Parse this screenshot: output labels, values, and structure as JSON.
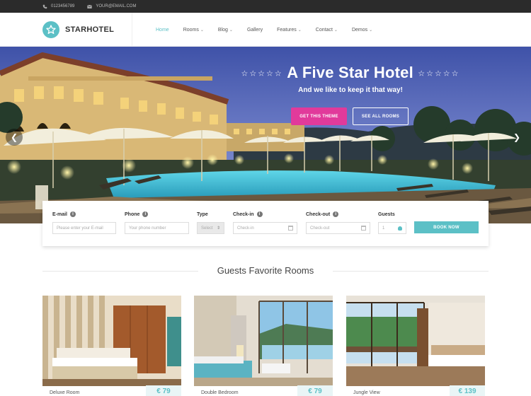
{
  "topbar": {
    "phone": "0123456789",
    "email": "YOUR@EMAIL.COM"
  },
  "brand": {
    "name": "STARHOTEL",
    "accent": "#5cc0c6",
    "pink": "#e13a9b"
  },
  "nav": {
    "items": [
      {
        "label": "Home",
        "dropdown": false,
        "active": true
      },
      {
        "label": "Rooms",
        "dropdown": true
      },
      {
        "label": "Blog",
        "dropdown": true
      },
      {
        "label": "Gallery",
        "dropdown": false
      },
      {
        "label": "Features",
        "dropdown": true
      },
      {
        "label": "Contact",
        "dropdown": true
      },
      {
        "label": "Demos",
        "dropdown": true
      }
    ]
  },
  "hero": {
    "title": "A Five Star Hotel",
    "stars_left": "☆☆☆☆☆",
    "stars_right": "☆☆☆☆☆",
    "subtitle": "And we like to keep it that way!",
    "primary_button": "GET THIS THEME",
    "secondary_button": "SEE ALL ROOMS"
  },
  "booking": {
    "email_label": "E-mail",
    "email_placeholder": "Please enter your E-mail",
    "phone_label": "Phone",
    "phone_placeholder": "Your phone number",
    "type_label": "Type",
    "type_value": "Select",
    "checkin_label": "Check-in",
    "checkin_placeholder": "Check-in",
    "checkout_label": "Check-out",
    "checkout_placeholder": "Check-out",
    "guests_label": "Guests",
    "guests_value": "1",
    "book_button": "BOOK NOW"
  },
  "rooms_section": {
    "title": "Guests Favorite Rooms",
    "rooms": [
      {
        "name": "Deluxe Room",
        "price": "€ 79"
      },
      {
        "name": "Double Bedroom",
        "price": "€ 79"
      },
      {
        "name": "Jungle View",
        "price": "€ 139"
      }
    ]
  }
}
